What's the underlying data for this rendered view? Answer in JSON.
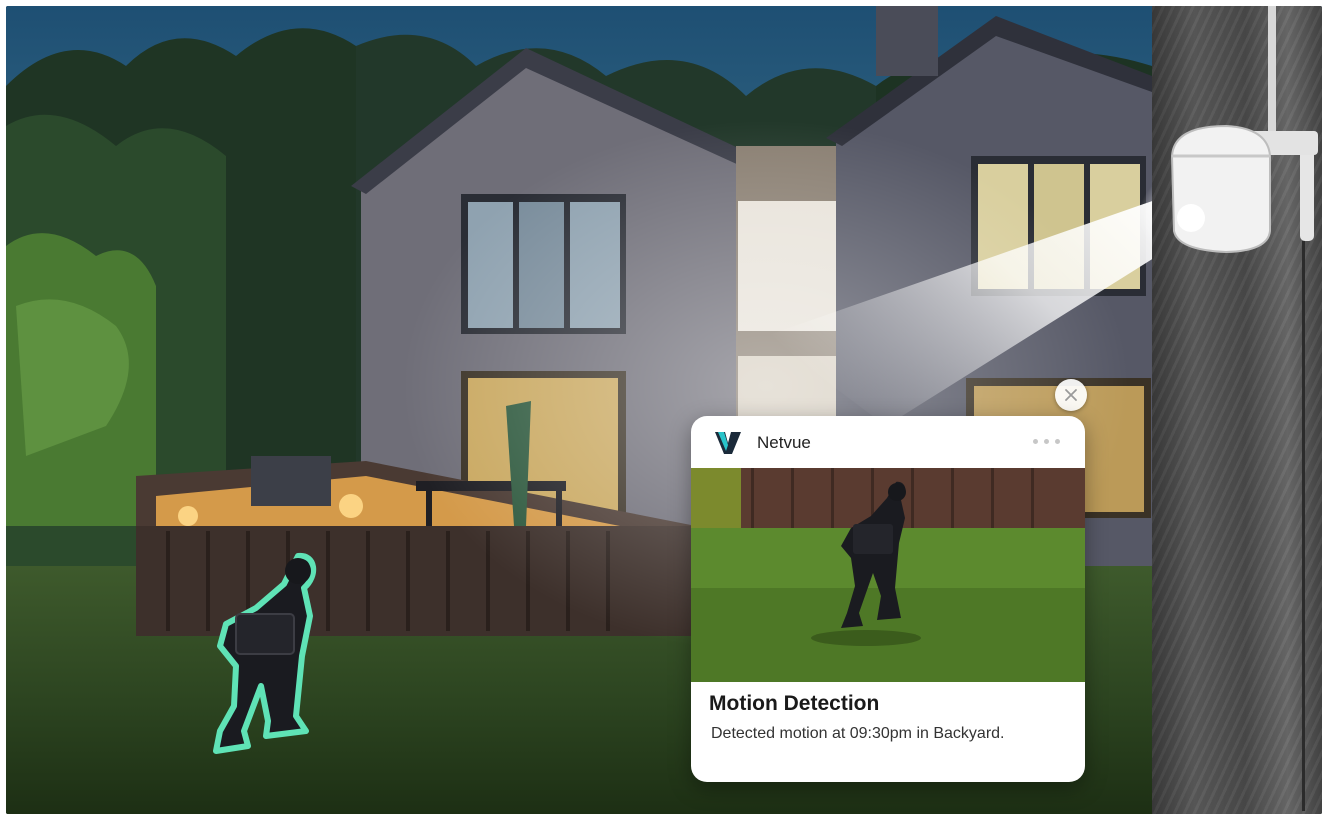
{
  "notification": {
    "app_name": "Netvue",
    "title": "Motion Detection",
    "message": "Detected motion at 09:30pm in Backyard."
  },
  "icons": {
    "close": "close-icon",
    "more": "more-options-icon",
    "logo": "netvue-logo-icon"
  },
  "colors": {
    "logo_accent": "#29c3c9",
    "logo_dark": "#1b2a3a",
    "outline_glow": "#5fe3b6",
    "card_background": "#ffffff"
  }
}
